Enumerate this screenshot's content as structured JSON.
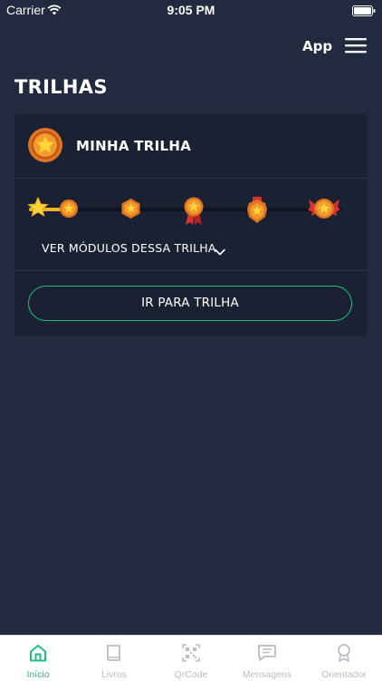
{
  "status_bar": {
    "carrier": "Carrier",
    "time": "9:05 PM"
  },
  "header": {
    "app_label": "App"
  },
  "page": {
    "title": "TRILHAS"
  },
  "card": {
    "title": "MINHA TRILHA",
    "modules_label": "VER MÓDULOS DESSA TRILHA",
    "button_label": "IR PARA TRILHA",
    "progress": 0.11
  },
  "tabs": [
    {
      "label": "Início",
      "icon": "home-icon",
      "active": true
    },
    {
      "label": "Livros",
      "icon": "book-icon",
      "active": false
    },
    {
      "label": "QrCode",
      "icon": "qrcode-icon",
      "active": false
    },
    {
      "label": "Mensagens",
      "icon": "message-icon",
      "active": false
    },
    {
      "label": "Orientador",
      "icon": "award-icon",
      "active": false
    }
  ],
  "colors": {
    "background": "#222a3f",
    "card": "#1a2133",
    "accent": "#1fbf7f",
    "gold": "#f2b12a",
    "medal_orange": "#e0741f",
    "ribbon_red": "#d8322f",
    "tab_inactive": "#b9bcc4"
  }
}
